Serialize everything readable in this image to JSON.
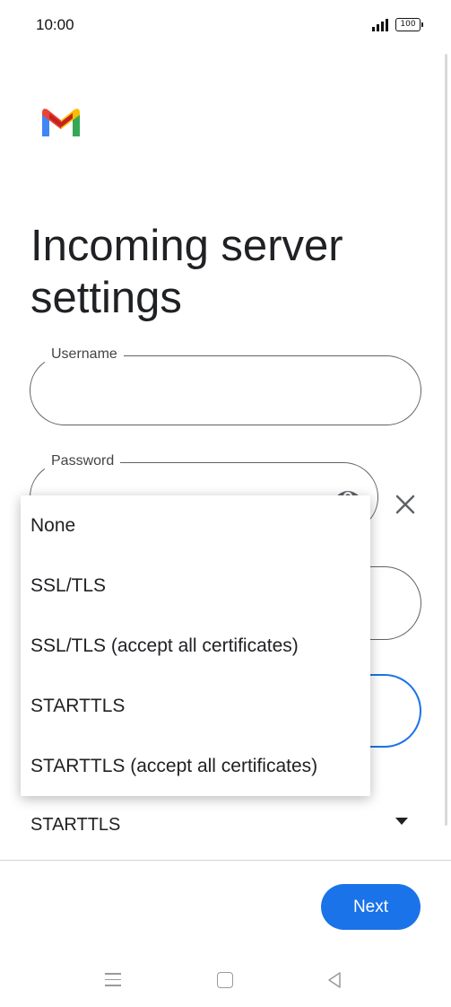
{
  "status_bar": {
    "time": "10:00",
    "battery": "100"
  },
  "header": {
    "title": "Incoming server settings"
  },
  "form": {
    "username": {
      "label": "Username",
      "value": ""
    },
    "password": {
      "label": "Password",
      "value": ""
    },
    "security": {
      "selected": "STARTTLS"
    }
  },
  "dropdown": {
    "options": [
      "None",
      "SSL/TLS",
      "SSL/TLS (accept all certificates)",
      "STARTTLS",
      "STARTTLS (accept all certificates)"
    ]
  },
  "footer": {
    "next_label": "Next"
  },
  "colors": {
    "accent": "#1a73e8"
  }
}
